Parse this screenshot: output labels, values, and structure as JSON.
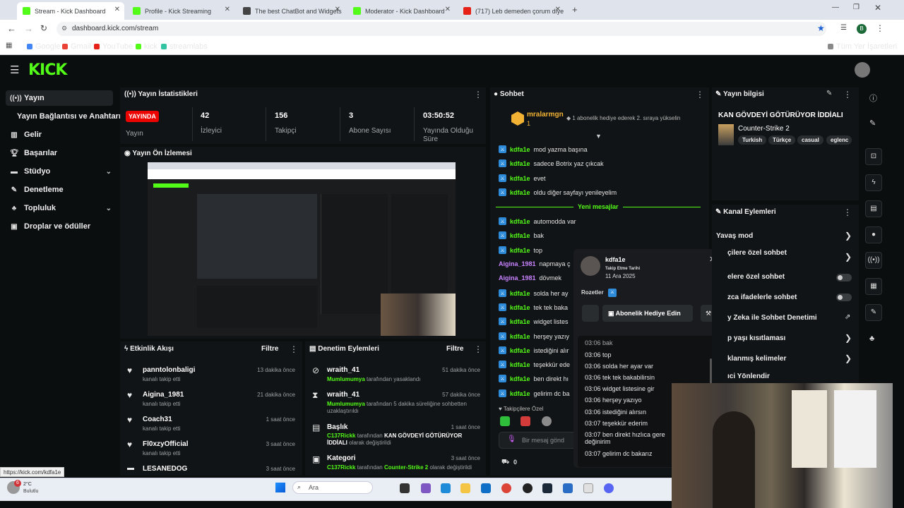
{
  "browser": {
    "tabs": [
      {
        "label": "Stream - Kick Dashboard",
        "active": true
      },
      {
        "label": "Profile - Kick Streaming",
        "active": false
      },
      {
        "label": "The best ChatBot and Widgets",
        "active": false
      },
      {
        "label": "Moderator - Kick Dashboard",
        "active": false
      },
      {
        "label": "(717) Leb demeden çorum diye",
        "active": false
      }
    ],
    "url": "dashboard.kick.com/stream",
    "profile_initial": "B",
    "bookmarks": [
      "Google",
      "Gmail",
      "YouTube",
      "kick",
      "streamlabs"
    ],
    "all_bookmarks": "Tüm Yer İşaretleri"
  },
  "header": {
    "logo": "KICK"
  },
  "sidebar": {
    "items": [
      {
        "label": "Yayın",
        "icon": "broadcast-icon",
        "selected": true
      },
      {
        "label": "Yayın Bağlantısı ve Anahtarı",
        "icon": "",
        "selected": false
      },
      {
        "label": "Gelir",
        "icon": "chart-icon",
        "selected": false
      },
      {
        "label": "Başarılar",
        "icon": "trophy-icon",
        "selected": false
      },
      {
        "label": "Stüdyo",
        "icon": "studio-icon",
        "selected": false,
        "chevron": true
      },
      {
        "label": "Denetleme",
        "icon": "wrench-icon",
        "selected": false
      },
      {
        "label": "Topluluk",
        "icon": "community-icon",
        "selected": false,
        "chevron": true
      },
      {
        "label": "Droplar ve ödüller",
        "icon": "gift-icon",
        "selected": false
      }
    ]
  },
  "stats": {
    "title": "Yayın İstatistikleri",
    "live_badge": "YAYINDA",
    "live_label": "Yayın",
    "viewers_value": "42",
    "viewers_label": "İzleyici",
    "followers_value": "156",
    "followers_label": "Takipçi",
    "subs_value": "3",
    "subs_label": "Abone Sayısı",
    "uptime_value": "03:50:52",
    "uptime_label": "Yayında Olduğu Süre"
  },
  "preview": {
    "title": "Yayın Ön İzlemesi"
  },
  "activity": {
    "title": "Etkinlik Akışı",
    "filter": "Filtre",
    "items": [
      {
        "name": "panntolonbaligi",
        "sub": "kanalı takip etti",
        "time": "13 dakika önce"
      },
      {
        "name": "Aigina_1981",
        "sub": "kanalı takip etti",
        "time": "21 dakika önce"
      },
      {
        "name": "Coach31",
        "sub": "kanalı takip etti",
        "time": "1 saat önce"
      },
      {
        "name": "Fl0xzyOfficial",
        "sub": "kanalı takip etti",
        "time": "3 saat önce"
      },
      {
        "name": "LESANEDOG",
        "sub": "",
        "time": "3 saat önce"
      }
    ]
  },
  "moderation": {
    "title": "Denetim Eylemleri",
    "filter": "Filtre",
    "items": [
      {
        "name": "wraith_41",
        "actor": "Mumlumumya",
        "rest": "tarafından yasaklandı",
        "time": "51 dakika önce"
      },
      {
        "name": "wraith_41",
        "actor": "Mumlumumya",
        "rest": "tarafından 5 dakika süreliğine sohbetten uzaklaştırıldı",
        "time": "57 dakika önce"
      },
      {
        "name": "Başlık",
        "actor": "C137Rickk",
        "rest": "tarafından",
        "value": "KAN GÖVDEYİ GÖTÜRÜYOR İDDİALI",
        "rest2": "olarak değiştirildi",
        "time": "1 saat önce"
      },
      {
        "name": "Kategori",
        "actor": "C137Rickk",
        "rest": "tarafından",
        "value": "Counter-Strike 2",
        "rest2": "olarak değiştirildi",
        "time": "3 saat önce"
      }
    ]
  },
  "chat": {
    "title": "Sohbet",
    "pinned_user": "mralarmgn",
    "pinned_count": "1",
    "pinned_text": "1 abonelik hediye ederek 2. sıraya yükselin",
    "new_messages": "Yeni mesajlar",
    "messages_before": [
      {
        "user": "kdfa1e",
        "text": "mod yazma başına"
      },
      {
        "user": "kdfa1e",
        "text": "sadece Botrix yaz çıkcak"
      },
      {
        "user": "kdfa1e",
        "text": "evet"
      },
      {
        "user": "kdfa1e",
        "text": "oldu diğer sayfayı yenileyelim"
      }
    ],
    "messages_after": [
      {
        "user": "kdfa1e",
        "text": "automodda var",
        "pink": false
      },
      {
        "user": "kdfa1e",
        "text": "bak",
        "pink": false
      },
      {
        "user": "kdfa1e",
        "text": "top",
        "pink": false
      },
      {
        "user": "Aigina_1981",
        "text": "napmaya ç",
        "pink": true
      },
      {
        "user": "Aigina_1981",
        "text": "dövmek",
        "pink": true
      },
      {
        "user": "kdfa1e",
        "text": "solda her ay",
        "pink": false
      },
      {
        "user": "kdfa1e",
        "text": "tek tek baka",
        "pink": false
      },
      {
        "user": "kdfa1e",
        "text": "widget listes",
        "pink": false
      },
      {
        "user": "kdfa1e",
        "text": "herşey yazıy",
        "pink": false
      },
      {
        "user": "kdfa1e",
        "text": "istediğini alır",
        "pink": false
      },
      {
        "user": "kdfa1e",
        "text": "teşekkür ede",
        "pink": false
      },
      {
        "user": "kdfa1e",
        "text": "ben direkt hı",
        "pink": false
      },
      {
        "user": "kdfa1e",
        "text": "gelirim dc ba",
        "pink": false
      }
    ],
    "followers_only": "Takipçilere Özel",
    "input_placeholder": "Bir mesaj gönd",
    "points": "0"
  },
  "user_popup": {
    "username": "kdfa1e",
    "follow_label": "Takip Etme Tarihi",
    "follow_date": "11 Ara 2025",
    "badges_label": "Rozetler",
    "gift_button": "Abonelik Hediye Edin",
    "history": [
      "03:06 bak",
      "03:06 top",
      "03:06 solda her ayar var",
      "03:06 tek tek bakabilirsin",
      "03:06 widget listesine gir",
      "03:06 herşey yazıyo",
      "03:06 istediğini alırsın",
      "03:07 teşekkür ederim",
      "03:07 ben direkt hızlıca gere değinirim",
      "03:07 gelirim dc bakarız"
    ]
  },
  "stream_info": {
    "title": "Yayın bilgisi",
    "stream_title": "KAN GÖVDEYİ GÖTÜRÜYOR İDDİALI",
    "game": "Counter-Strike 2",
    "tags": [
      "Turkish",
      "Türkçe",
      "casual",
      "eglenc"
    ]
  },
  "channel_actions": {
    "title": "Kanal Eylemleri",
    "rows": [
      {
        "label": "Yavaş mod",
        "control": "arrow"
      },
      {
        "label": "çilere özel sohbet",
        "control": "arrow"
      },
      {
        "label": "elere özel sohbet",
        "control": "toggle"
      },
      {
        "label": "zca ifadelerle sohbet",
        "control": "toggle"
      },
      {
        "label": "y Zeka ile Sohbet Denetimi",
        "control": "ext"
      },
      {
        "label": "p yaşı kısıtlaması",
        "control": "arrow"
      },
      {
        "label": "klanmış kelimeler",
        "control": "arrow"
      },
      {
        "label": "ıci Yönlendir",
        "control": "none"
      }
    ]
  },
  "status_url": "https://kick.com/kdfa1e",
  "weather": {
    "temp": "2°C",
    "desc": "Bulutlu",
    "alert": "6"
  },
  "taskbar": {
    "search": "Ara"
  },
  "colors": {
    "accent": "#53fc18",
    "live": "#eb0400",
    "bg": "#0b0e0f",
    "panel": "#111416"
  }
}
